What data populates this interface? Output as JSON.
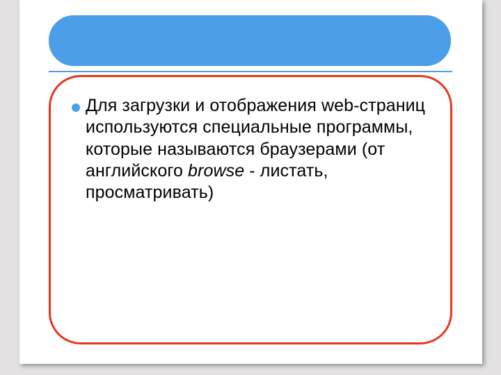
{
  "slide": {
    "body": {
      "pre": "Для загрузки и отображения web-страниц используются специальные программы, которые называются браузерами (от английского ",
      "italic": "browse",
      "post": " - листать, просматривать)"
    }
  },
  "colors": {
    "accent_blue": "#4d9ee8",
    "accent_red": "#e8341c",
    "page_bg": "#e3e1e2"
  }
}
